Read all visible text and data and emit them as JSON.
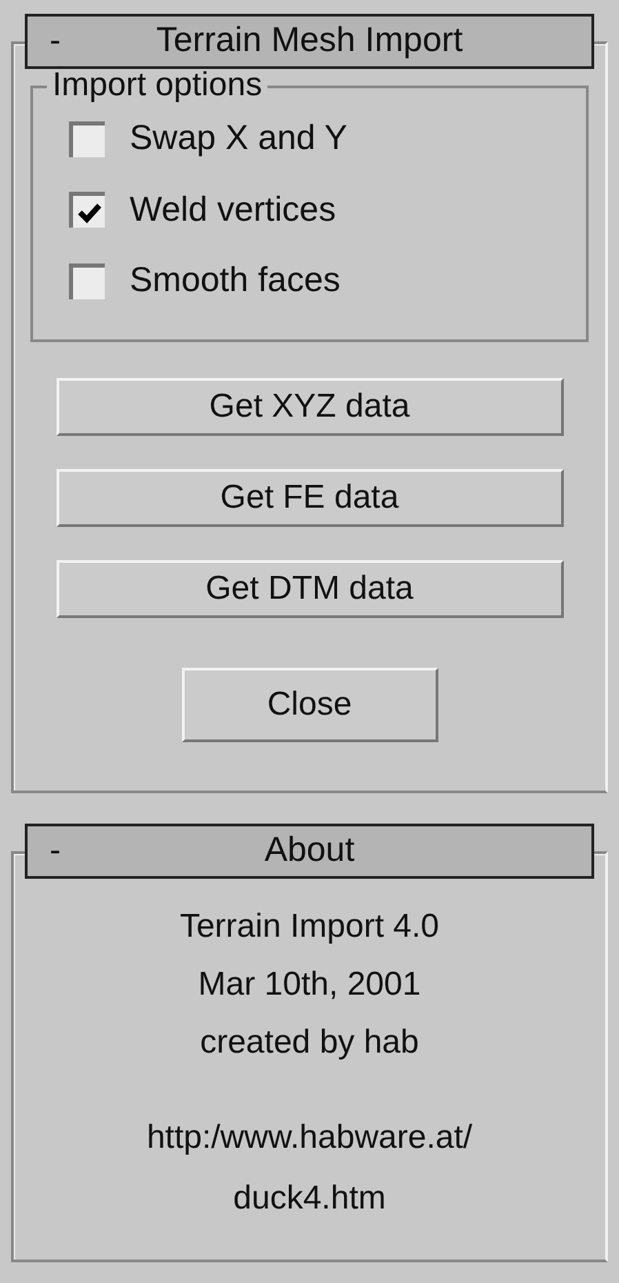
{
  "rollouts": [
    {
      "collapse_sign": "-",
      "title": "Terrain Mesh Import",
      "group": {
        "title": "Import options",
        "checkboxes": [
          {
            "label": "Swap X and Y",
            "checked": false
          },
          {
            "label": "Weld vertices",
            "checked": true
          },
          {
            "label": "Smooth faces",
            "checked": false
          }
        ]
      },
      "buttons": [
        "Get XYZ data",
        "Get FE data",
        "Get DTM data"
      ],
      "close_button": "Close"
    },
    {
      "collapse_sign": "-",
      "title": "About",
      "lines": [
        "Terrain Import 4.0",
        "Mar 10th, 2001",
        "created by hab"
      ],
      "link_lines": [
        "http:/www.habware.at/",
        "duck4.htm"
      ]
    }
  ]
}
